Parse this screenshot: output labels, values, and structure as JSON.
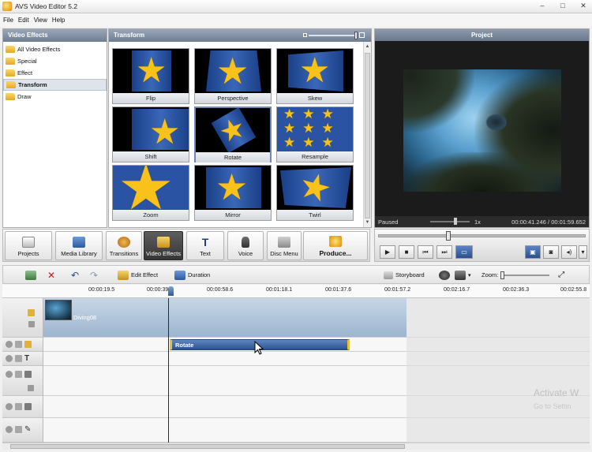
{
  "window": {
    "title": "AVS Video Editor 5.2",
    "min": "–",
    "max": "□",
    "close": "✕"
  },
  "menu": [
    "File",
    "Edit",
    "View",
    "Help"
  ],
  "effects_panel": {
    "header": "Video Effects",
    "items": [
      {
        "label": "All Video Effects",
        "selected": false
      },
      {
        "label": "Special",
        "selected": false
      },
      {
        "label": "Effect",
        "selected": false
      },
      {
        "label": "Transform",
        "selected": true
      },
      {
        "label": "Draw",
        "selected": false
      }
    ]
  },
  "transform_panel": {
    "header": "Transform",
    "thumbs": [
      "Flip",
      "Perspective",
      "Skew",
      "Shift",
      "Rotate",
      "Resample",
      "Zoom",
      "Mirror",
      "Twirl"
    ],
    "selected": "Rotate"
  },
  "project": {
    "header": "Project",
    "status": "Paused",
    "speed": "1x",
    "time": "00:00:41.246 / 00:01:59.652"
  },
  "toolbar": {
    "projects": "Projects",
    "media_library": "Media Library",
    "transitions": "Transitions",
    "video_effects": "Video Effects",
    "text": "Text",
    "voice": "Voice",
    "disc_menu": "Disc Menu",
    "produce": "Produce..."
  },
  "playback": {
    "play": "▶",
    "stop": "■",
    "prev": "⏮",
    "next": "⏭"
  },
  "timeline_toolbar": {
    "edit_effect": "Edit Effect",
    "duration": "Duration",
    "storyboard": "Storyboard",
    "zoom": "Zoom:"
  },
  "ruler": [
    "00:00:19.5",
    "00:00:39.0",
    "00:00:58.6",
    "00:01:18.1",
    "00:01:37.6",
    "00:01:57.2",
    "00:02:16.7",
    "00:02:36.3",
    "00:02:55.8"
  ],
  "timeline": {
    "video_clip": "Diving08",
    "effect_clip": "Rotate"
  },
  "watermark": {
    "title": "Activate W",
    "sub": "Go to Settin"
  },
  "colors": {
    "panel_header": "#7f8da2",
    "effect_clip": "#3a63a5",
    "star": "#f8c21a"
  }
}
